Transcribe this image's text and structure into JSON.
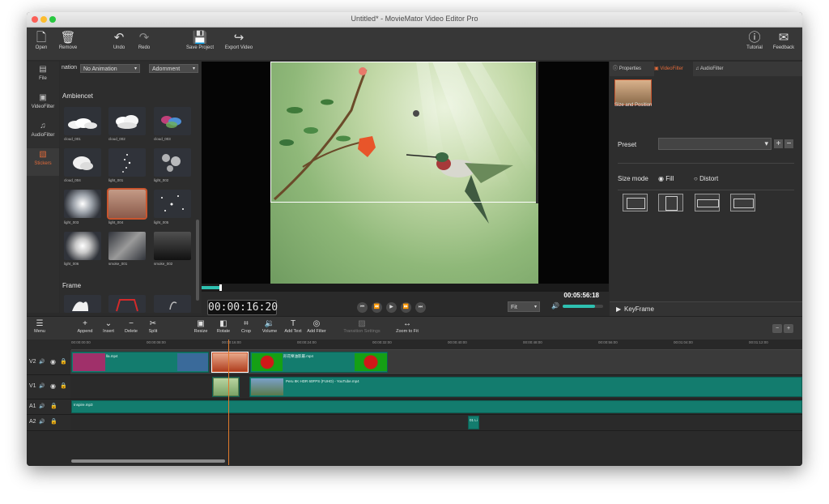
{
  "window": {
    "title": "Untitled* - MovieMator Video Editor Pro"
  },
  "toolbar": {
    "open": "Open",
    "remove": "Remove",
    "undo": "Undo",
    "redo": "Redo",
    "save_project": "Save Project",
    "export_video": "Export Video",
    "tutorial": "Tutorial",
    "feedback": "Feedback"
  },
  "left_tabs": [
    "File",
    "VideoFilter",
    "AudioFilter",
    "Stickers"
  ],
  "browser": {
    "animation_label": "nation",
    "animation_value": "No Animation",
    "category_value": "Adornment",
    "section_ambiencet": "Ambiencet",
    "section_frame": "Frame",
    "items": [
      "cloud_001",
      "cloud_002",
      "cloud_003",
      "cloud_004",
      "light_001",
      "light_002",
      "light_003",
      "light_004",
      "light_005",
      "light_006",
      "smoke_001",
      "smoke_002"
    ]
  },
  "player": {
    "timecode": "00:00:16:20",
    "duration": "00:05:56:18",
    "zoom_mode": "Fit",
    "volume_pct": 80,
    "progress_pct": 5
  },
  "properties": {
    "tabs": [
      "Properties",
      "VideoFilter",
      "AudioFilter"
    ],
    "filter_name": "Size and Position",
    "preset_label": "Preset",
    "size_mode_label": "Size mode",
    "fill_label": "Fill",
    "distort_label": "Distort",
    "keyframe_label": "KeyFrame"
  },
  "timeline_toolbar": {
    "menu": "Menu",
    "append": "Append",
    "insert": "Insert",
    "delete": "Delete",
    "split": "Split",
    "resize": "Resize",
    "rotate": "Rotate",
    "crop": "Crop",
    "volume": "Volume",
    "add_text": "Add Text",
    "add_filter": "Add Filter",
    "transition_settings": "Transition Settings",
    "zoom_to_fit": "Zoom to Fit"
  },
  "ruler": [
    "00:00:00:00",
    "00:00:08:00",
    "00:00:16:00",
    "00:00:24:00",
    "00:00:32:00",
    "00:00:40:00",
    "00:00:48:00",
    "00:00:56:00",
    "00:01:04:00",
    "00:01:12:00"
  ],
  "tracks": {
    "v2": "V2",
    "v1": "V1",
    "a1": "A1",
    "a2": "A2"
  },
  "clips": {
    "v2_a": "lla.mp4",
    "v2_b": "形花樂油影屬.mp4",
    "v1_a": "Peru 8K HDR 60FPS (FUHD) - YouTube.mp4",
    "a1_a": "Inspire.mp3",
    "a2_a": "01 Li"
  },
  "colors": {
    "accent": "#e06a3a",
    "clip": "#137c6e",
    "background": "#2b2b2b"
  }
}
